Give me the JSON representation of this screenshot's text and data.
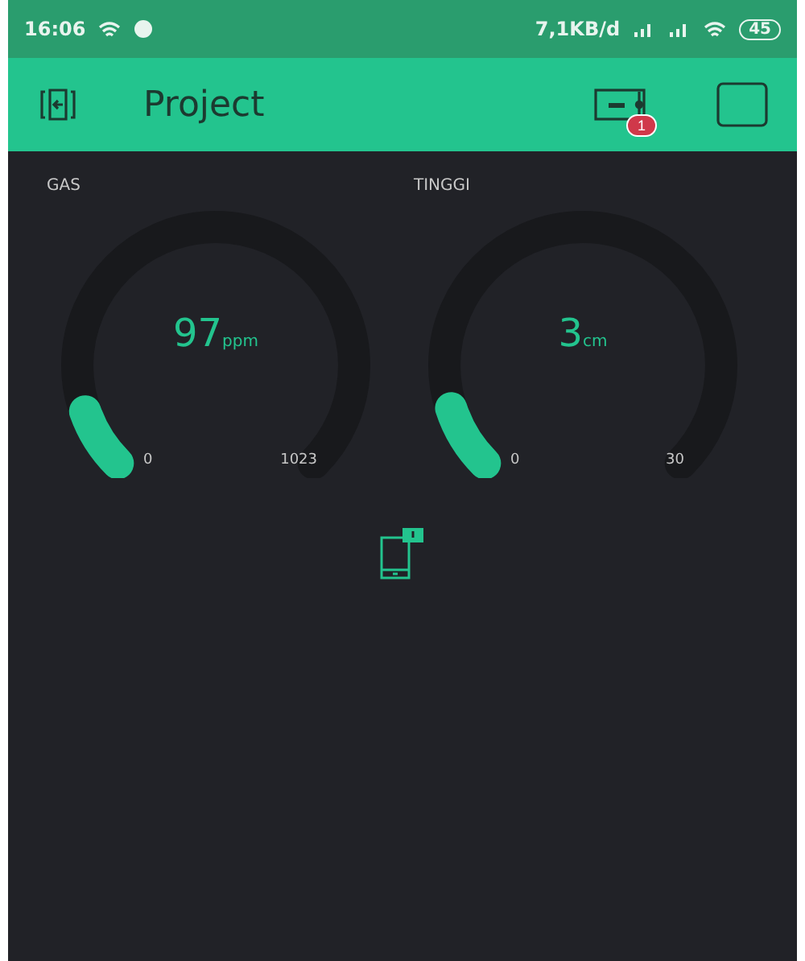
{
  "status_bar": {
    "time": "16:06",
    "speed": "7,1KB/d",
    "battery": "45"
  },
  "header": {
    "title": "Project",
    "notification_count": "1"
  },
  "gauges": [
    {
      "label": "GAS",
      "value": "97",
      "unit": "ppm",
      "min": "0",
      "max": "1023"
    },
    {
      "label": "TINGGI",
      "value": "3",
      "unit": "cm",
      "min": "0",
      "max": "30"
    }
  ]
}
